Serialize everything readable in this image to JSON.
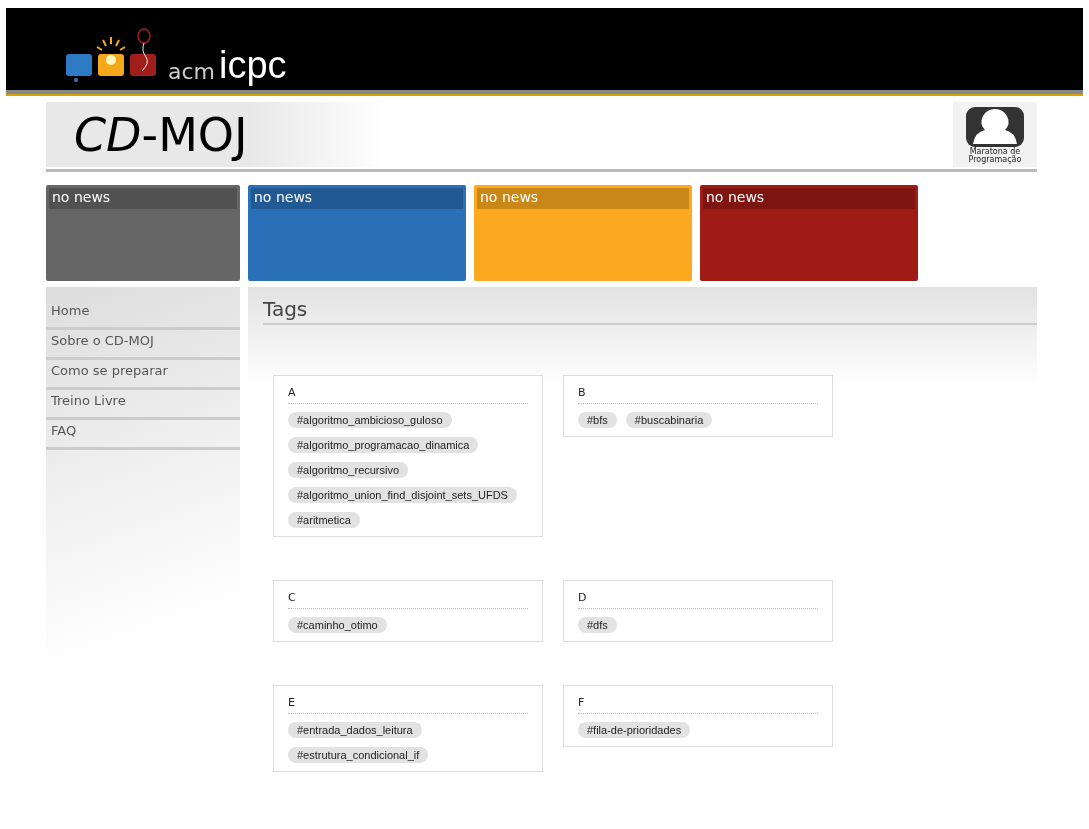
{
  "banner": {
    "logo_text": "acm",
    "logo_text_bold": "icpc"
  },
  "header": {
    "title_italic": "CD",
    "title_rest": "-MOJ",
    "badge_lines": [
      "Maratona de",
      "Programação"
    ]
  },
  "news": [
    {
      "label": "no news",
      "color": "#666666"
    },
    {
      "label": "no news",
      "color": "#2a70b8"
    },
    {
      "label": "no news",
      "color": "#fca91f"
    },
    {
      "label": "no news",
      "color": "#9e1b16"
    }
  ],
  "sidebar": {
    "items": [
      "Home",
      "Sobre o CD-MOJ",
      "Como se preparar",
      "Treino Livre",
      "FAQ"
    ]
  },
  "content": {
    "title": "Tags",
    "groups": [
      {
        "letter": "A",
        "tags": [
          "#algoritmo_ambicioso_guloso",
          "#algoritmo_programacao_dinamica",
          "#algoritmo_recursivo",
          "#algoritmo_union_find_disjoint_sets_UFDS",
          "#aritmetica"
        ]
      },
      {
        "letter": "B",
        "tags": [
          "#bfs",
          "#buscabinaria"
        ]
      },
      {
        "letter": "C",
        "tags": [
          "#caminho_otimo"
        ]
      },
      {
        "letter": "D",
        "tags": [
          "#dfs"
        ]
      },
      {
        "letter": "E",
        "tags": [
          "#entrada_dados_leitura",
          "#estrutura_condicional_if"
        ]
      },
      {
        "letter": "F",
        "tags": [
          "#fila-de-prioridades"
        ]
      }
    ]
  }
}
